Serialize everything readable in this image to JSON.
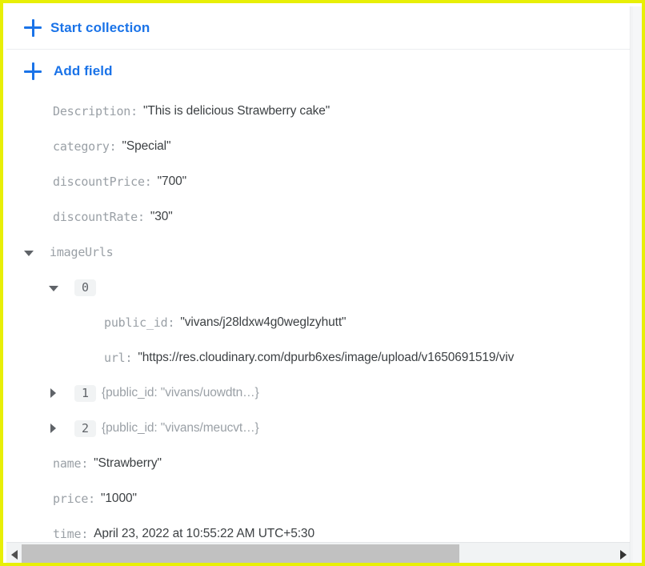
{
  "actions": {
    "start_collection": "Start collection",
    "add_field": "Add field",
    "plus_icon": "plus-icon"
  },
  "fields": [
    {
      "key": "Description:",
      "value": "\"This is delicious Strawberry cake\""
    },
    {
      "key": "category:",
      "value": "\"Special\""
    },
    {
      "key": "discountPrice:",
      "value": "\"700\""
    },
    {
      "key": "discountRate:",
      "value": "\"30\""
    },
    {
      "key": "imageUrls",
      "value": ""
    },
    {
      "key": "name:",
      "value": "\"Strawberry\""
    },
    {
      "key": "price:",
      "value": "\"1000\""
    },
    {
      "key": "time:",
      "value": "April 23, 2022 at 10:55:22 AM UTC+5:30"
    }
  ],
  "image_urls": {
    "label": "imageUrls",
    "items": [
      {
        "index": "0",
        "expanded": true,
        "preview": "",
        "children": [
          {
            "key": "public_id:",
            "value": "\"vivans/j28ldxw4g0weglzyhutt\""
          },
          {
            "key": "url:",
            "value": "\"https://res.cloudinary.com/dpurb6xes/image/upload/v1650691519/viv"
          }
        ]
      },
      {
        "index": "1",
        "expanded": false,
        "preview": "{public_id: \"vivans/uowdtn…}",
        "children": []
      },
      {
        "index": "2",
        "expanded": false,
        "preview": "{public_id: \"vivans/meucvt…}",
        "children": []
      }
    ]
  },
  "scrollbar": {
    "left_arrow": "scroll-left-arrow",
    "right_arrow": "scroll-right-arrow",
    "thumb": "scroll-thumb"
  },
  "colors": {
    "link_blue": "#1a73e8",
    "key_gray": "#9aa0a6",
    "value_dark": "#3c4043",
    "chip_bg": "#f1f3f4",
    "border_yellow": "#e8ef06"
  }
}
